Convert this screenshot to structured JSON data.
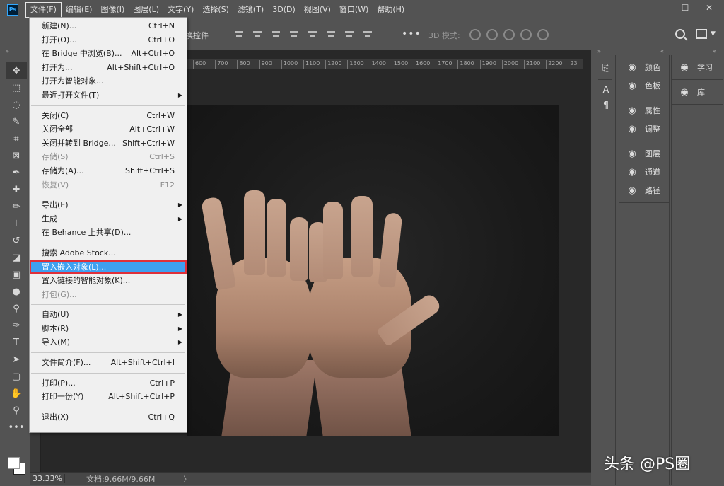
{
  "app": {
    "logo": "Ps"
  },
  "menubar": {
    "items": [
      "文件(F)",
      "编辑(E)",
      "图像(I)",
      "图层(L)",
      "文字(Y)",
      "选择(S)",
      "滤镜(T)",
      "3D(D)",
      "视图(V)",
      "窗口(W)",
      "帮助(H)"
    ],
    "active_index": 0
  },
  "window_controls": {
    "minimize": "—",
    "restore": "☐",
    "close": "✕"
  },
  "options_bar": {
    "partial_label": "换控件",
    "more": "•••",
    "mode_3d": "3D 模式:"
  },
  "ruler": {
    "ticks": [
      "600",
      "700",
      "800",
      "900",
      "1000",
      "1100",
      "1200",
      "1300",
      "1400",
      "1500",
      "1600",
      "1700",
      "1800",
      "1900",
      "2000",
      "2100",
      "2200",
      "23"
    ]
  },
  "status_bar": {
    "zoom": "33.33%",
    "doc_size": "文档:9.66M/9.66M",
    "arrow": "〉"
  },
  "file_menu": {
    "groups": [
      [
        {
          "label": "新建(N)...",
          "shortcut": "Ctrl+N"
        },
        {
          "label": "打开(O)...",
          "shortcut": "Ctrl+O"
        },
        {
          "label": "在 Bridge 中浏览(B)...",
          "shortcut": "Alt+Ctrl+O"
        },
        {
          "label": "打开为...",
          "shortcut": "Alt+Shift+Ctrl+O"
        },
        {
          "label": "打开为智能对象...",
          "shortcut": ""
        },
        {
          "label": "最近打开文件(T)",
          "shortcut": "",
          "submenu": true
        }
      ],
      [
        {
          "label": "关闭(C)",
          "shortcut": "Ctrl+W"
        },
        {
          "label": "关闭全部",
          "shortcut": "Alt+Ctrl+W"
        },
        {
          "label": "关闭并转到 Bridge...",
          "shortcut": "Shift+Ctrl+W"
        },
        {
          "label": "存储(S)",
          "shortcut": "Ctrl+S",
          "disabled": true
        },
        {
          "label": "存储为(A)...",
          "shortcut": "Shift+Ctrl+S"
        },
        {
          "label": "恢复(V)",
          "shortcut": "F12",
          "disabled": true
        }
      ],
      [
        {
          "label": "导出(E)",
          "shortcut": "",
          "submenu": true
        },
        {
          "label": "生成",
          "shortcut": "",
          "submenu": true
        },
        {
          "label": "在 Behance 上共享(D)...",
          "shortcut": ""
        }
      ],
      [
        {
          "label": "搜索 Adobe Stock...",
          "shortcut": ""
        },
        {
          "label": "置入嵌入对象(L)...",
          "shortcut": "",
          "highlighted": true
        },
        {
          "label": "置入链接的智能对象(K)...",
          "shortcut": ""
        },
        {
          "label": "打包(G)...",
          "shortcut": "",
          "disabled": true
        }
      ],
      [
        {
          "label": "自动(U)",
          "shortcut": "",
          "submenu": true
        },
        {
          "label": "脚本(R)",
          "shortcut": "",
          "submenu": true
        },
        {
          "label": "导入(M)",
          "shortcut": "",
          "submenu": true
        }
      ],
      [
        {
          "label": "文件简介(F)...",
          "shortcut": "Alt+Shift+Ctrl+I"
        }
      ],
      [
        {
          "label": "打印(P)...",
          "shortcut": "Ctrl+P"
        },
        {
          "label": "打印一份(Y)",
          "shortcut": "Alt+Shift+Ctrl+P"
        }
      ],
      [
        {
          "label": "退出(X)",
          "shortcut": "Ctrl+Q"
        }
      ]
    ]
  },
  "panels": {
    "col1": [
      [
        {
          "label": "颜色",
          "icon": "palette-icon"
        },
        {
          "label": "色板",
          "icon": "swatches-icon"
        }
      ],
      [
        {
          "label": "属性",
          "icon": "properties-icon"
        },
        {
          "label": "调整",
          "icon": "adjustments-icon"
        }
      ],
      [
        {
          "label": "图层",
          "icon": "layers-icon"
        },
        {
          "label": "通道",
          "icon": "channels-icon"
        },
        {
          "label": "路径",
          "icon": "paths-icon"
        }
      ]
    ],
    "col2": [
      [
        {
          "label": "学习",
          "icon": "learn-icon"
        }
      ],
      [
        {
          "label": "库",
          "icon": "libraries-icon"
        }
      ]
    ]
  },
  "watermark": "头条 @PS圈",
  "colors": {
    "highlight": "#3fa0f0",
    "highlight_border": "#e0303a",
    "ps_blue": "#31a8ff"
  }
}
